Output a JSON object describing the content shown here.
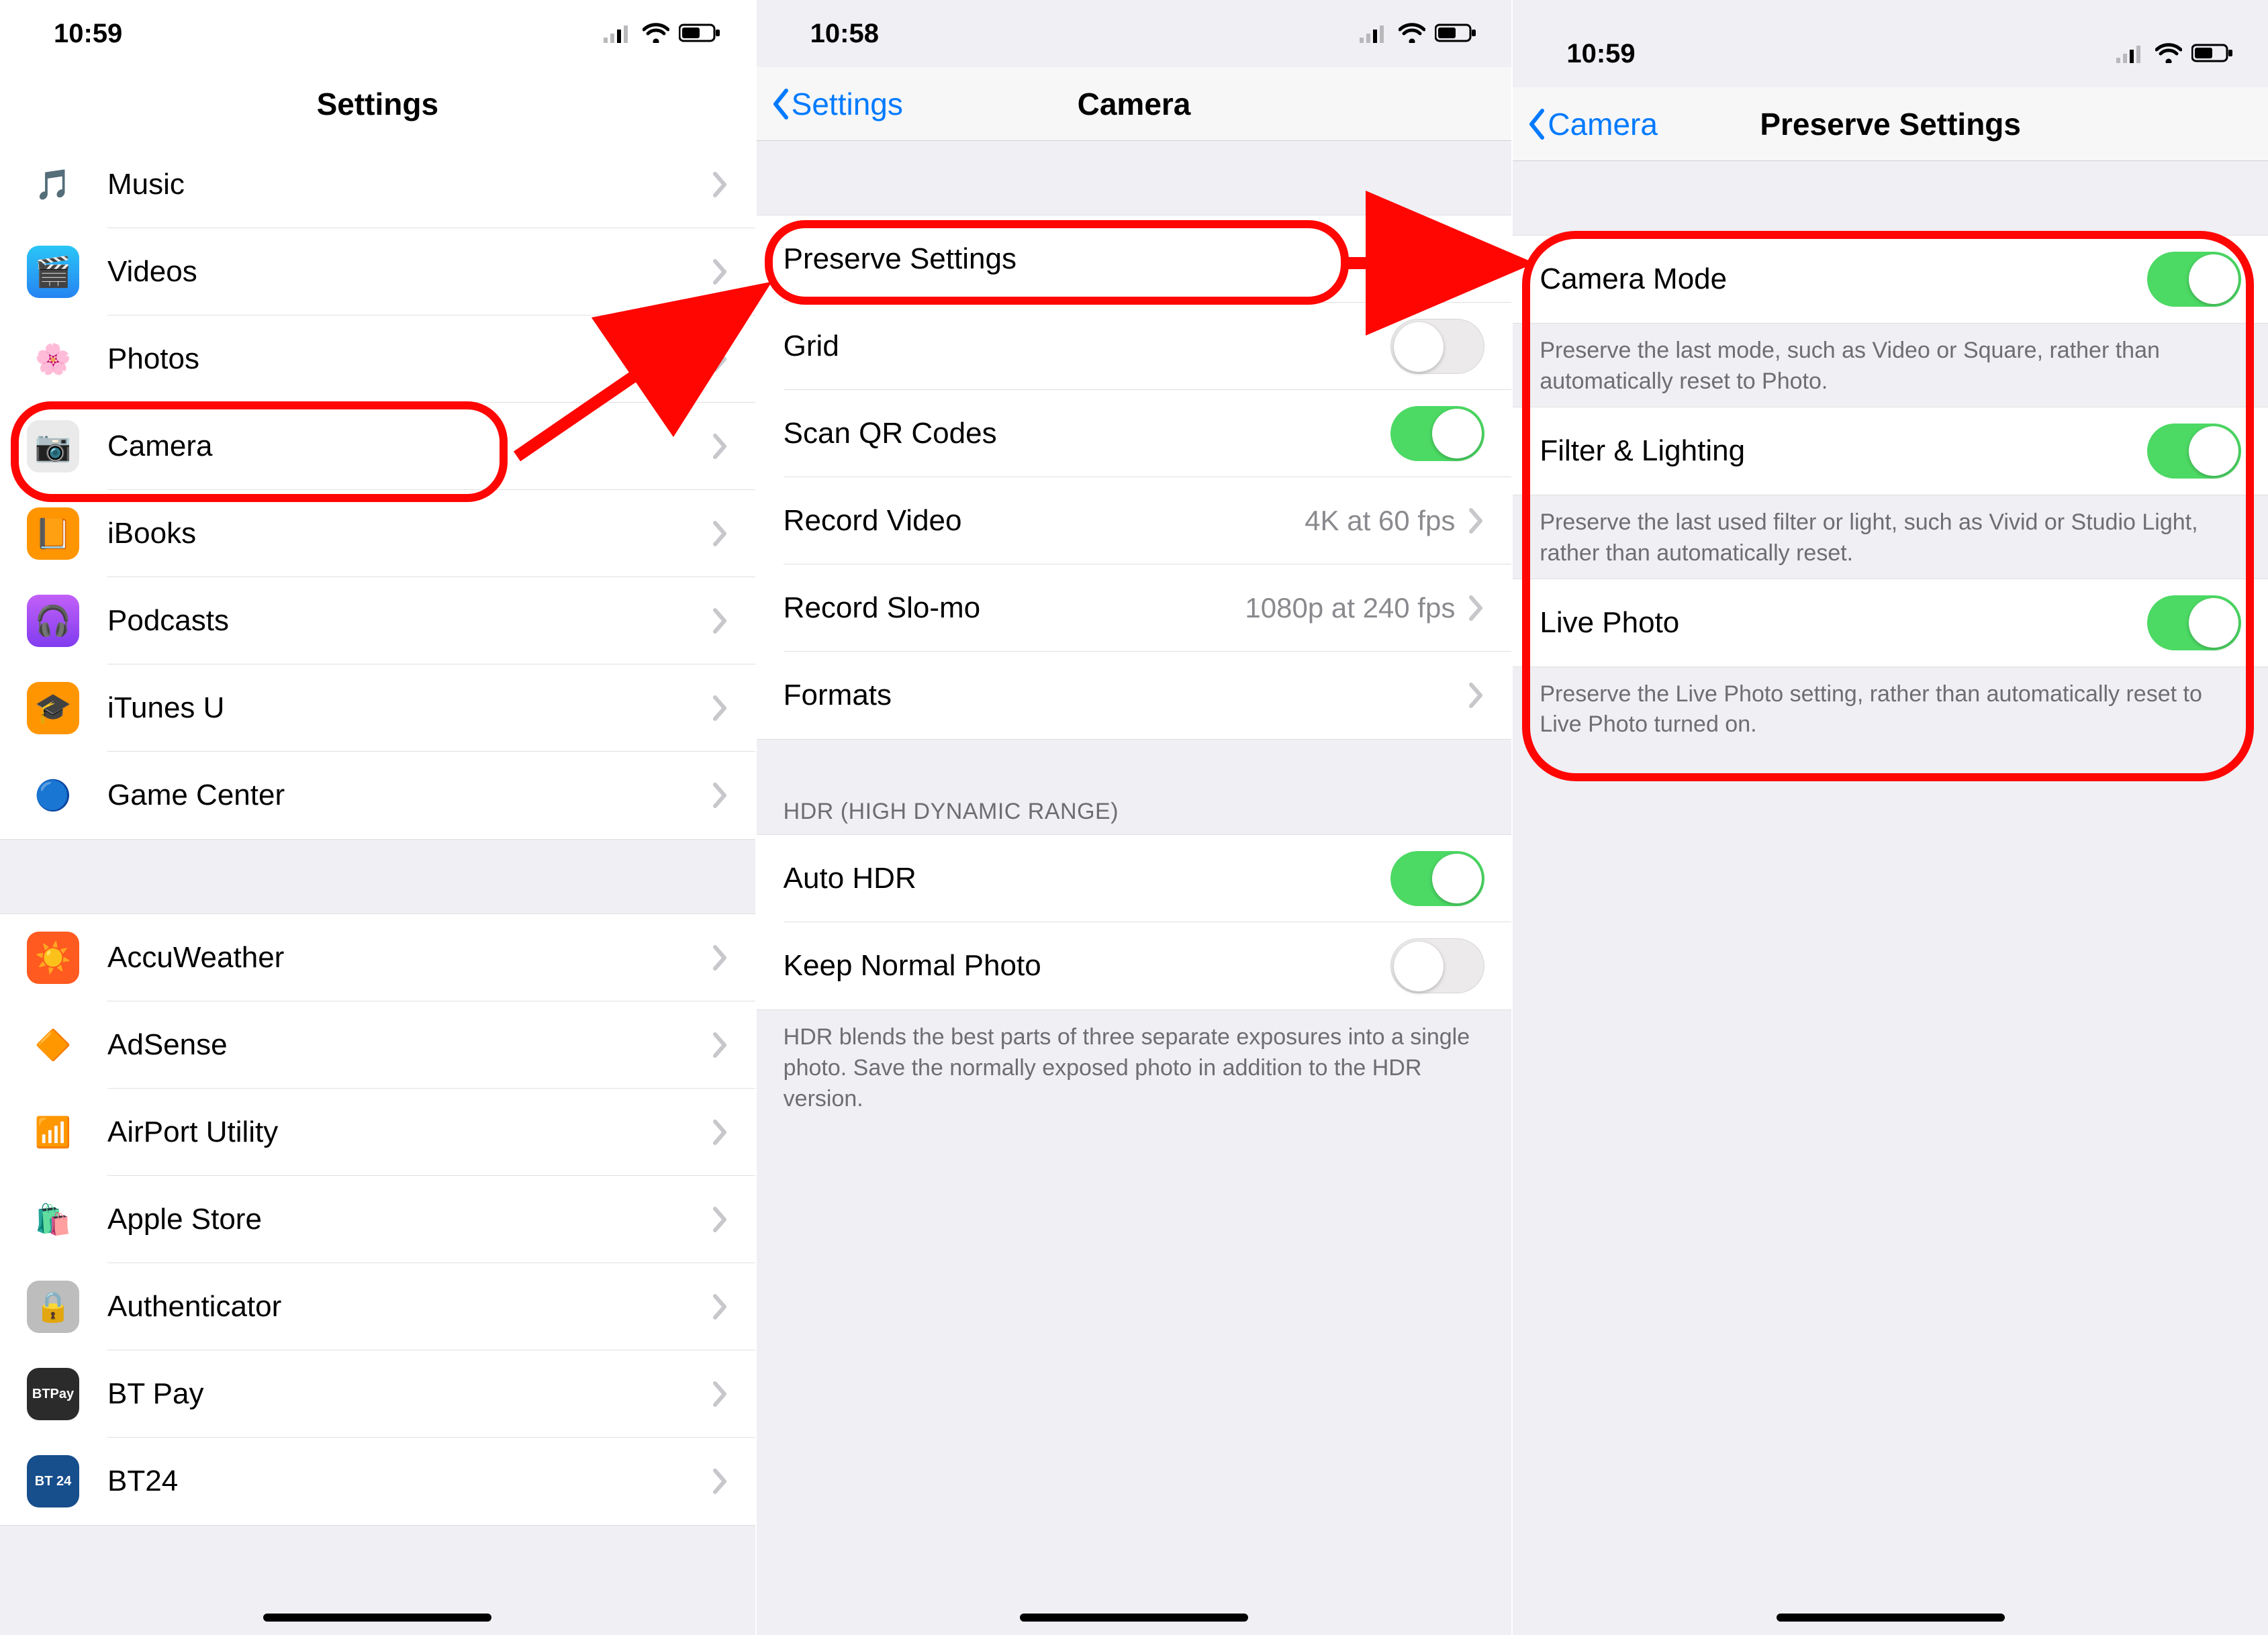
{
  "screen1": {
    "time": "10:59",
    "title": "Settings",
    "groupA": [
      {
        "icon": "music-icon",
        "label": "Music",
        "bg": "#fff",
        "emoji": "🎵"
      },
      {
        "icon": "videos-icon",
        "label": "Videos",
        "bg": "linear-gradient(#2ac6f6,#2583f2)",
        "emoji": "🎬"
      },
      {
        "icon": "photos-icon",
        "label": "Photos",
        "bg": "#fff",
        "emoji": "🌸"
      },
      {
        "icon": "camera-icon",
        "label": "Camera",
        "bg": "#eaeaea",
        "emoji": "📷"
      },
      {
        "icon": "ibooks-icon",
        "label": "iBooks",
        "bg": "#ff9500",
        "emoji": "📙"
      },
      {
        "icon": "podcasts-icon",
        "label": "Podcasts",
        "bg": "linear-gradient(#c260f8,#813cf0)",
        "emoji": "🎧"
      },
      {
        "icon": "itunesu-icon",
        "label": "iTunes U",
        "bg": "#ff9500",
        "emoji": "🎓"
      },
      {
        "icon": "gamecenter-icon",
        "label": "Game Center",
        "bg": "#fff",
        "emoji": "🔵"
      }
    ],
    "groupB": [
      {
        "icon": "accuweather-icon",
        "label": "AccuWeather",
        "bg": "#ff5a1f",
        "emoji": "☀️"
      },
      {
        "icon": "adsense-icon",
        "label": "AdSense",
        "bg": "#fff",
        "emoji": "🔶"
      },
      {
        "icon": "airport-icon",
        "label": "AirPort Utility",
        "bg": "#fff",
        "emoji": "📶"
      },
      {
        "icon": "applestore-icon",
        "label": "Apple Store",
        "bg": "#fff",
        "emoji": "🛍️"
      },
      {
        "icon": "authenticator-icon",
        "label": "Authenticator",
        "bg": "#bdbdbd",
        "emoji": "🔒"
      },
      {
        "icon": "btpay-icon",
        "label": "BT Pay",
        "bg": "#2b2b2b",
        "emoji": "💳",
        "text": "BTPay"
      },
      {
        "icon": "bt24-icon",
        "label": "BT24",
        "bg": "#174e8c",
        "emoji": "🏦",
        "text": "BT 24"
      }
    ]
  },
  "screen2": {
    "time": "10:58",
    "back": "Settings",
    "title": "Camera",
    "groupA": [
      {
        "label": "Preserve Settings",
        "chevron": true
      },
      {
        "label": "Grid",
        "toggle": "off"
      },
      {
        "label": "Scan QR Codes",
        "toggle": "on"
      },
      {
        "label": "Record Video",
        "detail": "4K at 60 fps",
        "chevron": true
      },
      {
        "label": "Record Slo-mo",
        "detail": "1080p at 240 fps",
        "chevron": true
      },
      {
        "label": "Formats",
        "chevron": true
      }
    ],
    "hdrHeader": "HDR (HIGH DYNAMIC RANGE)",
    "groupB": [
      {
        "label": "Auto HDR",
        "toggle": "on"
      },
      {
        "label": "Keep Normal Photo",
        "toggle": "off"
      }
    ],
    "hdrFooter": "HDR blends the best parts of three separate exposures into a single photo. Save the normally exposed photo in addition to the HDR version."
  },
  "screen3": {
    "time": "10:59",
    "back": "Camera",
    "title": "Preserve Settings",
    "items": [
      {
        "label": "Camera Mode",
        "toggle": "on",
        "footer": "Preserve the last mode, such as Video or Square, rather than automatically reset to Photo."
      },
      {
        "label": "Filter & Lighting",
        "toggle": "on",
        "footer": "Preserve the last used filter or light, such as Vivid or Studio Light, rather than automatically reset."
      },
      {
        "label": "Live Photo",
        "toggle": "on",
        "footer": "Preserve the Live Photo setting, rather than automatically reset to Live Photo turned on."
      }
    ]
  }
}
